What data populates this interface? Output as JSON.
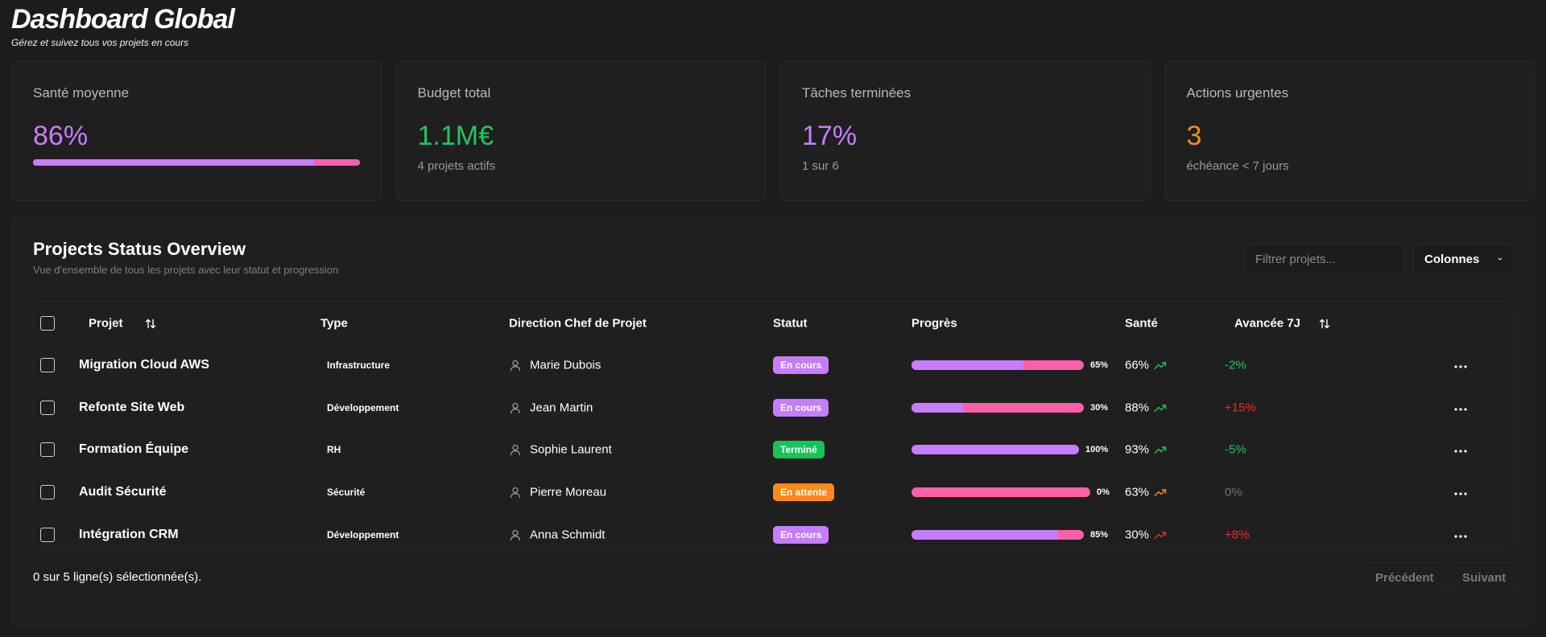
{
  "header": {
    "title": "Dashboard Global",
    "subtitle": "Gérez et suivez tous vos projets en cours"
  },
  "cards": {
    "health": {
      "label": "Santé moyenne",
      "value": "86%",
      "value_fraction": 0.86,
      "color": "#c77dff"
    },
    "budget": {
      "label": "Budget total",
      "value": "1.1M€",
      "note": "4 projets actifs",
      "color": "#22c55e"
    },
    "tasks": {
      "label": "Tâches terminées",
      "value": "17%",
      "note": "1 sur 6",
      "color": "#c77dff"
    },
    "urgent": {
      "label": "Actions urgentes",
      "value": "3",
      "note": "échéance < 7 jours",
      "color": "#ff8a1a"
    }
  },
  "panel": {
    "title": "Projects Status Overview",
    "subtitle": "Vue d'ensemble de tous les projets avec leur statut et progression",
    "filter_placeholder": "Filtrer projets...",
    "columns_button": "Colonnes"
  },
  "table": {
    "headers": {
      "project": "Projet",
      "type": "Type",
      "manager": "Direction Chef de Projet",
      "status": "Statut",
      "progress": "Progrès",
      "health": "Santé",
      "trend7": "Avancée 7J"
    },
    "rows": [
      {
        "project": "Migration Cloud AWS",
        "type": "Infrastructure",
        "manager": "Marie Dubois",
        "status": "En cours",
        "status_color": "#c77dff",
        "progress": 65,
        "progress_label": "65%",
        "health": "66%",
        "health_trend": "up",
        "health_trend_color": "#22c55e",
        "trend7": "-2%",
        "trend7_color": "#22c55e"
      },
      {
        "project": "Refonte Site Web",
        "type": "Développement",
        "manager": "Jean Martin",
        "status": "En cours",
        "status_color": "#c77dff",
        "progress": 30,
        "progress_label": "30%",
        "health": "88%",
        "health_trend": "up",
        "health_trend_color": "#22c55e",
        "trend7": "+15%",
        "trend7_color": "#ef2b2b"
      },
      {
        "project": "Formation Équipe",
        "type": "RH",
        "manager": "Sophie Laurent",
        "status": "Terminé",
        "status_color": "#16c45b",
        "progress": 100,
        "progress_label": "100%",
        "health": "93%",
        "health_trend": "up",
        "health_trend_color": "#22c55e",
        "trend7": "-5%",
        "trend7_color": "#22c55e"
      },
      {
        "project": "Audit Sécurité",
        "type": "Sécurité",
        "manager": "Pierre Moreau",
        "status": "En attente",
        "status_color": "#ff8a1a",
        "progress": 0,
        "progress_label": "0%",
        "health": "63%",
        "health_trend": "up",
        "health_trend_color": "#ff8a1a",
        "trend7": "0%",
        "trend7_color": "#6b7280"
      },
      {
        "project": "Intégration CRM",
        "type": "Développement",
        "manager": "Anna Schmidt",
        "status": "En cours",
        "status_color": "#c77dff",
        "progress": 85,
        "progress_label": "85%",
        "health": "30%",
        "health_trend": "up",
        "health_trend_color": "#ef2b2b",
        "trend7": "+8%",
        "trend7_color": "#ef2b2b"
      }
    ]
  },
  "footer": {
    "selection": "0 sur 5 ligne(s) sélectionnée(s).",
    "prev": "Précédent",
    "next": "Suivant"
  }
}
